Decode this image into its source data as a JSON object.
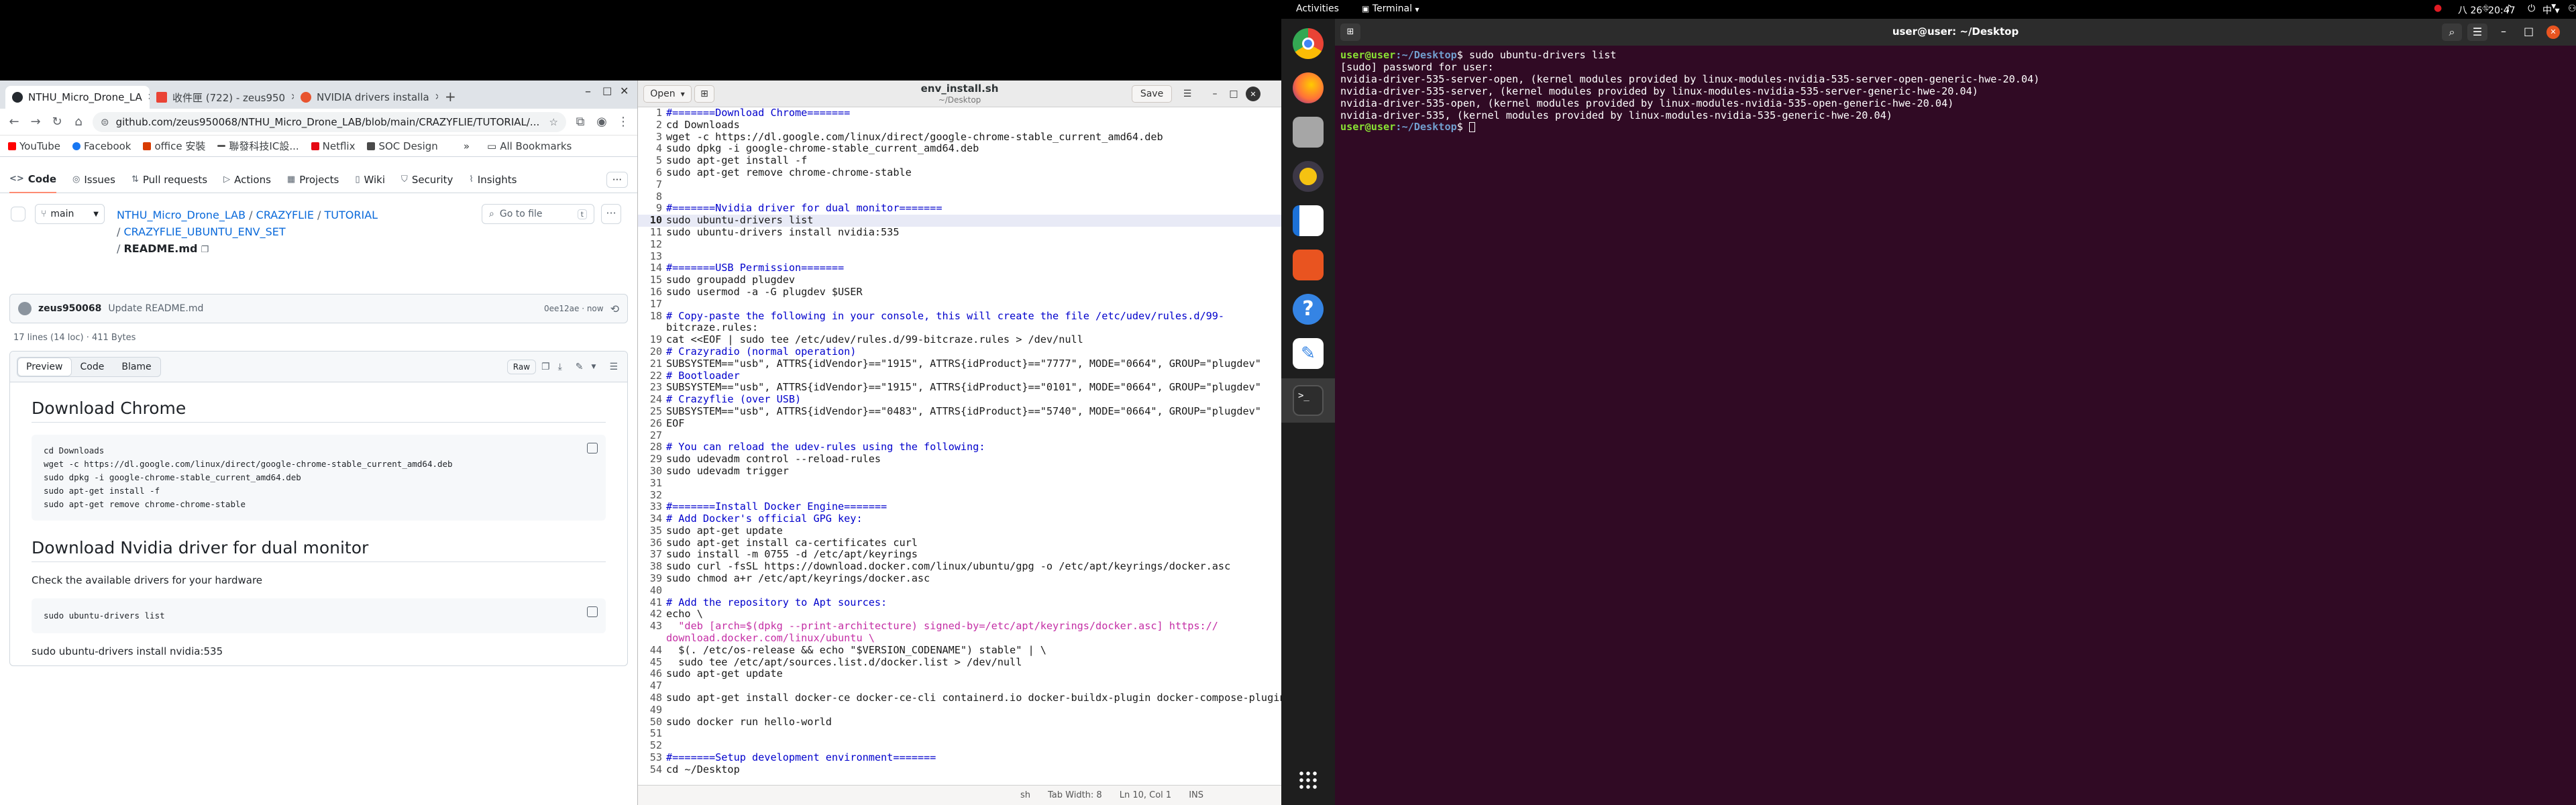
{
  "chrome": {
    "tabs": [
      {
        "title": "NTHU_Micro_Drone_LA",
        "favicon_color": "#24292f",
        "active": true
      },
      {
        "title": "收件匣 (722) - zeus950",
        "favicon_color": "#ea4335",
        "active": false
      },
      {
        "title": "NVIDIA drivers installa",
        "favicon_color": "#e8542f",
        "active": false
      }
    ],
    "new_tab": "+",
    "url": "github.com/zeus950068/NTHU_Micro_Drone_LAB/blob/main/CRAZYFLIE/TUTORIAL/...",
    "bookmarks": [
      {
        "label": "YouTube",
        "color": "#ff0000"
      },
      {
        "label": "Facebook",
        "color": "#1877f2"
      },
      {
        "label": "office 安裝",
        "color": "#d83b01"
      },
      {
        "label": "聯發科技IC設...",
        "color": "#555555"
      },
      {
        "label": "Netflix",
        "color": "#e50914"
      },
      {
        "label": "SOC Design",
        "color": "#4a4a4a"
      }
    ],
    "all_bookmarks": "All Bookmarks"
  },
  "github": {
    "nav": [
      "Code",
      "Issues",
      "Pull requests",
      "Actions",
      "Projects",
      "Wiki",
      "Security",
      "Insights"
    ],
    "branch": "main",
    "go_to_file": "Go to file",
    "go_to_file_key": "t",
    "breadcrumb": {
      "repo": "NTHU_Micro_Drone_LAB",
      "sep": "/",
      "p1": "CRAZYFLIE",
      "p2": "TUTORIAL",
      "p3": "CRAZYFLIE_UBUNTU_ENV_SET",
      "file": "README.md"
    },
    "commit": {
      "author": "zeus950068",
      "message": "Update README.md",
      "hash_time": "0ee12ae · now"
    },
    "file_info": "17 lines (14 loc) · 411 Bytes",
    "view_tabs": [
      "Preview",
      "Code",
      "Blame"
    ],
    "raw": "Raw",
    "readme": {
      "h1": "Download Chrome",
      "code1": [
        "cd Downloads",
        "wget -c https://dl.google.com/linux/direct/google-chrome-stable_current_amd64.deb",
        "sudo dpkg -i google-chrome-stable_current_amd64.deb",
        "sudo apt-get install -f",
        "sudo apt-get remove chrome-chrome-stable"
      ],
      "h2": "Download Nvidia driver for dual monitor",
      "p1": "Check the available drivers for your hardware",
      "code2": [
        "sudo ubuntu-drivers list"
      ],
      "p2": "sudo ubuntu-drivers install nvidia:535"
    }
  },
  "gedit": {
    "open": "Open",
    "title": "env_install.sh",
    "subtitle": "~/Desktop",
    "save": "Save",
    "lines": [
      "#=======Download Chrome=======",
      "cd Downloads",
      "wget -c https://dl.google.com/linux/direct/google-chrome-stable_current_amd64.deb",
      "sudo dpkg -i google-chrome-stable_current_amd64.deb",
      "sudo apt-get install -f",
      "sudo apt-get remove chrome-chrome-stable",
      "",
      "",
      "#=======Nvidia driver for dual monitor=======",
      "sudo ubuntu-drivers list",
      "sudo ubuntu-drivers install nvidia:535",
      "",
      "",
      "#=======USB Permission=======",
      "sudo groupadd plugdev",
      "sudo usermod -a -G plugdev $USER",
      "",
      "# Copy-paste the following in your console, this will create the file /etc/udev/rules.d/99-",
      "bitcraze.rules:",
      "cat <<EOF | sudo tee /etc/udev/rules.d/99-bitcraze.rules > /dev/null",
      "# Crazyradio (normal operation)",
      "SUBSYSTEM==\"usb\", ATTRS{idVendor}==\"1915\", ATTRS{idProduct}==\"7777\", MODE=\"0664\", GROUP=\"plugdev\"",
      "# Bootloader",
      "SUBSYSTEM==\"usb\", ATTRS{idVendor}==\"1915\", ATTRS{idProduct}==\"0101\", MODE=\"0664\", GROUP=\"plugdev\"",
      "# Crazyflie (over USB)",
      "SUBSYSTEM==\"usb\", ATTRS{idVendor}==\"0483\", ATTRS{idProduct}==\"5740\", MODE=\"0664\", GROUP=\"plugdev\"",
      "EOF",
      "",
      "# You can reload the udev-rules using the following:",
      "sudo udevadm control --reload-rules",
      "sudo udevadm trigger",
      "",
      "",
      "#=======Install Docker Engine=======",
      "# Add Docker's official GPG key:",
      "sudo apt-get update",
      "sudo apt-get install ca-certificates curl",
      "sudo install -m 0755 -d /etc/apt/keyrings",
      "sudo curl -fsSL https://download.docker.com/linux/ubuntu/gpg -o /etc/apt/keyrings/docker.asc",
      "sudo chmod a+r /etc/apt/keyrings/docker.asc",
      "",
      "# Add the repository to Apt sources:",
      "echo \\",
      "  \"deb [arch=$(dpkg --print-architecture) signed-by=/etc/apt/keyrings/docker.asc] https://",
      "download.docker.com/linux/ubuntu \\",
      "  $(. /etc/os-release && echo \"$VERSION_CODENAME\") stable\" | \\",
      "  sudo tee /etc/apt/sources.list.d/docker.list > /dev/null",
      "sudo apt-get update",
      "",
      "sudo apt-get install docker-ce docker-ce-cli containerd.io docker-buildx-plugin docker-compose-plugin",
      "",
      "sudo docker run hello-world",
      "",
      "",
      "#=======Setup development environment=======",
      "cd ~/Desktop"
    ],
    "numbers": [
      "1",
      "2",
      "3",
      "4",
      "5",
      "6",
      "7",
      "8",
      "9",
      "10",
      "11",
      "12",
      "13",
      "14",
      "15",
      "16",
      "17",
      "18",
      "",
      "19",
      "20",
      "21",
      "22",
      "23",
      "24",
      "25",
      "26",
      "27",
      "28",
      "29",
      "30",
      "31",
      "32",
      "33",
      "34",
      "35",
      "36",
      "37",
      "38",
      "39",
      "40",
      "41",
      "42",
      "43",
      "",
      "44",
      "45",
      "46",
      "47",
      "48",
      "49",
      "50",
      "51",
      "52",
      "53",
      "54"
    ],
    "status": {
      "lang": "sh",
      "tab": "Tab Width: 8",
      "pos": "Ln 10, Col 1",
      "mode": "INS"
    }
  },
  "gnome": {
    "activities": "Activities",
    "app": "Terminal",
    "clock": "八 26  20:47",
    "input": "中"
  },
  "terminal": {
    "title": "user@user: ~/Desktop",
    "prompt_user": "user@user",
    "prompt_path": ":~/Desktop",
    "prompt_sym": "$ ",
    "command": "sudo ubuntu-drivers list",
    "output": [
      "[sudo] password for user:",
      "nvidia-driver-535-server-open, (kernel modules provided by linux-modules-nvidia-535-server-open-generic-hwe-20.04)",
      "nvidia-driver-535-server, (kernel modules provided by linux-modules-nvidia-535-server-generic-hwe-20.04)",
      "nvidia-driver-535-open, (kernel modules provided by linux-modules-nvidia-535-open-generic-hwe-20.04)",
      "nvidia-driver-535, (kernel modules provided by linux-modules-nvidia-535-generic-hwe-20.04)"
    ]
  }
}
